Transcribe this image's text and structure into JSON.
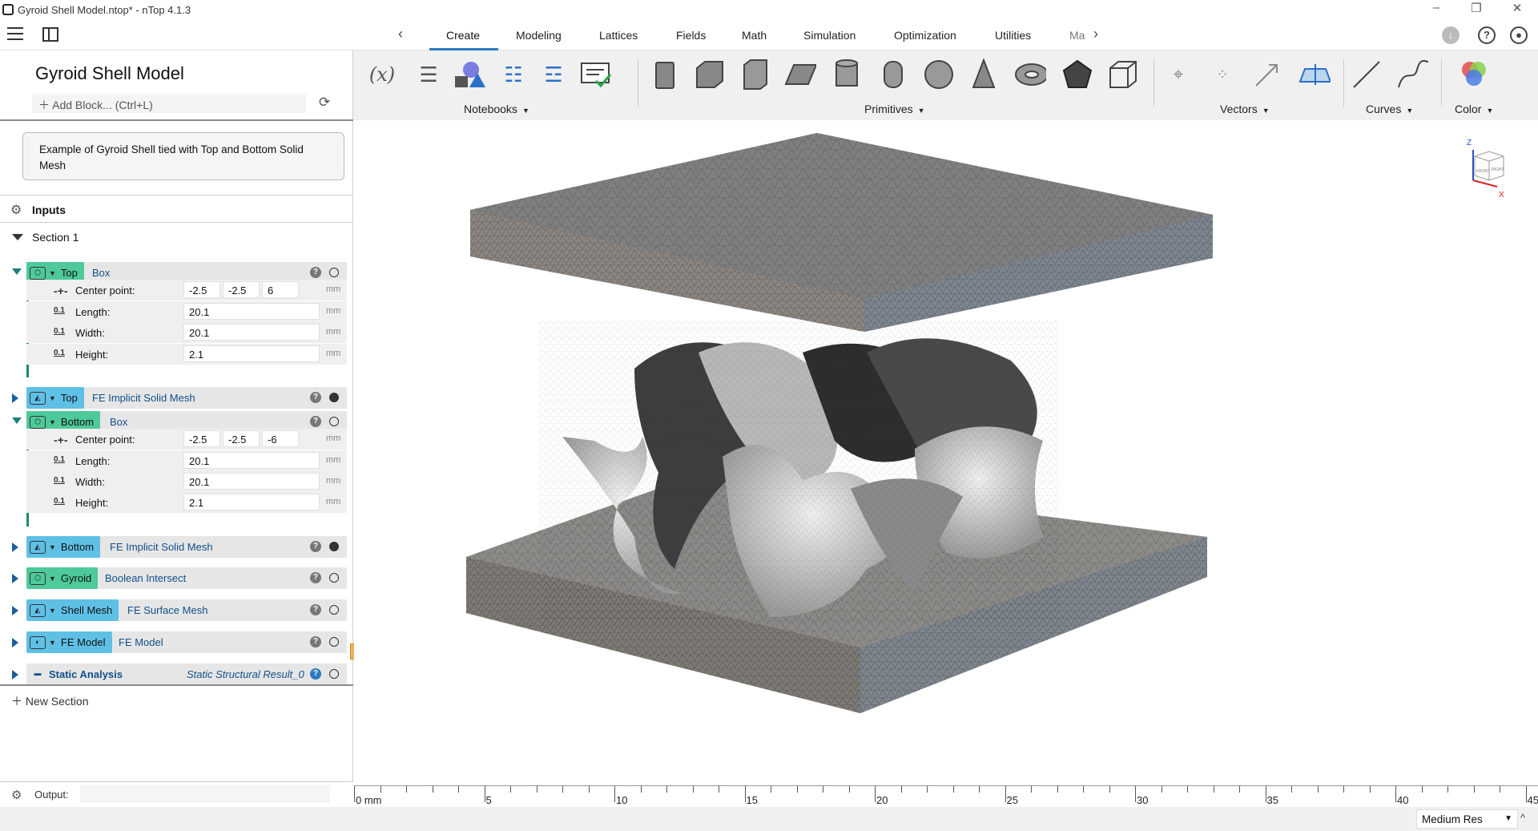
{
  "window": {
    "title": "Gyroid Shell Model.ntop* - nTop 4.1.3"
  },
  "menu": {
    "tabs": [
      "Create",
      "Modeling",
      "Lattices",
      "Fields",
      "Math",
      "Simulation",
      "Optimization",
      "Utilities",
      "Ma"
    ],
    "active_tab": "Create"
  },
  "toolbar": {
    "groups": [
      "Notebooks",
      "Primitives",
      "Vectors",
      "Curves",
      "Color"
    ],
    "notebook_var_label": "(x)"
  },
  "notebook": {
    "title": "Gyroid Shell Model",
    "add_block_placeholder": "Add Block... (Ctrl+L)",
    "description": "Example of Gyroid Shell tied with Top and Bottom Solid Mesh",
    "inputs_label": "Inputs",
    "section_label": "Section 1",
    "new_section_label": "New Section",
    "output_label": "Output:",
    "blocks": [
      {
        "name": "Top",
        "type": "Box",
        "open": true,
        "color": "#4ec99a"
      },
      {
        "name": "Top",
        "type": "FE Implicit Solid Mesh",
        "open": false,
        "color": "#5fc0e6"
      },
      {
        "name": "Bottom",
        "type": "Box",
        "open": true,
        "color": "#4ec99a"
      },
      {
        "name": "Bottom",
        "type": "FE Implicit Solid Mesh",
        "open": false,
        "color": "#5fc0e6"
      },
      {
        "name": "Gyroid",
        "type": "Boolean Intersect",
        "open": false,
        "color": "#4ec99a"
      },
      {
        "name": "Shell Mesh",
        "type": "FE Surface Mesh",
        "open": false,
        "color": "#5fc0e6"
      },
      {
        "name": "FE Model",
        "type": "FE Model",
        "open": false,
        "color": "#5fc0e6"
      },
      {
        "name": "Static Analysis",
        "type": "Static Structural Result_0",
        "open": false,
        "color": "#e8e8e8"
      }
    ],
    "top_box": {
      "center_label": "Center point:",
      "center": [
        "-2.5",
        "-2.5",
        "6"
      ],
      "length_label": "Length:",
      "length": "20.1",
      "width_label": "Width:",
      "width": "20.1",
      "height_label": "Height:",
      "height": "2.1",
      "unit": "mm"
    },
    "bottom_box": {
      "center_label": "Center point:",
      "center": [
        "-2.5",
        "-2.5",
        "-6"
      ],
      "length_label": "Length:",
      "length": "20.1",
      "width_label": "Width:",
      "width": "20.1",
      "height_label": "Height:",
      "height": "2.1",
      "unit": "mm"
    }
  },
  "ruler": {
    "labels": [
      "0 mm",
      "5",
      "10",
      "15",
      "20",
      "25",
      "30",
      "35",
      "40",
      "45"
    ]
  },
  "status": {
    "resolution": "Medium Res"
  },
  "viewcube": {
    "faces": [
      "FRONT",
      "RIGHT"
    ],
    "axes": [
      "Z",
      "X"
    ]
  }
}
